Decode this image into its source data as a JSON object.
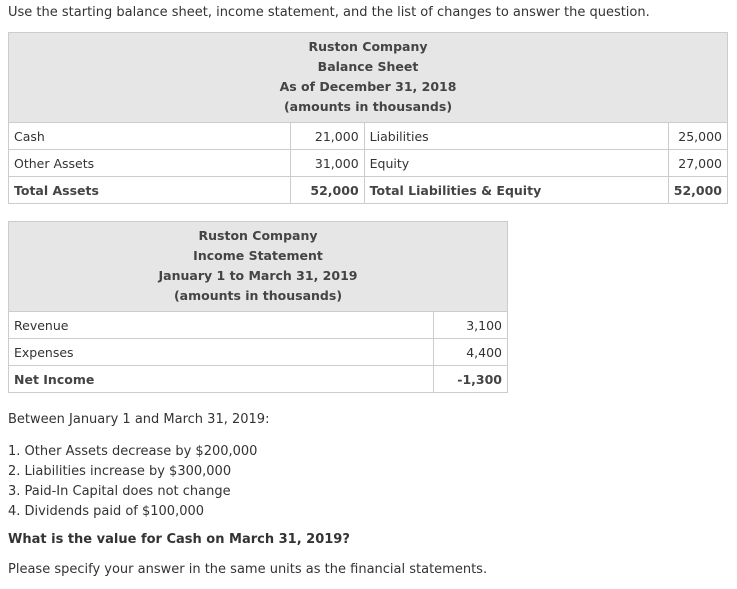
{
  "intro": "Use the starting balance sheet, income statement, and the list of changes to answer the question.",
  "balance_sheet": {
    "header": [
      "Ruston Company",
      "Balance Sheet",
      "As of December 31, 2018",
      "(amounts in thousands)"
    ],
    "rows": [
      {
        "left_label": "Cash",
        "left_value": "21,000",
        "right_label": "Liabilities",
        "right_value": "25,000"
      },
      {
        "left_label": "Other Assets",
        "left_value": "31,000",
        "right_label": "Equity",
        "right_value": "27,000"
      },
      {
        "left_label": "Total Assets",
        "left_value": "52,000",
        "right_label": "Total Liabilities & Equity",
        "right_value": "52,000"
      }
    ]
  },
  "income_statement": {
    "header": [
      "Ruston Company",
      "Income Statement",
      "January 1 to March 31, 2019",
      "(amounts in thousands)"
    ],
    "rows": [
      {
        "label": "Revenue",
        "value": "3,100"
      },
      {
        "label": "Expenses",
        "value": "4,400"
      },
      {
        "label": "Net Income",
        "value": "-1,300"
      }
    ]
  },
  "between_text": "Between January 1 and March 31, 2019:",
  "changes": [
    "1. Other Assets decrease by $200,000",
    "2. Liabilities increase by $300,000",
    "3. Paid-In Capital does not change",
    "4. Dividends paid of $100,000"
  ],
  "question": "What is the value for Cash on March 31, 2019?",
  "instruction": "Please specify your answer in the same units as the financial statements."
}
